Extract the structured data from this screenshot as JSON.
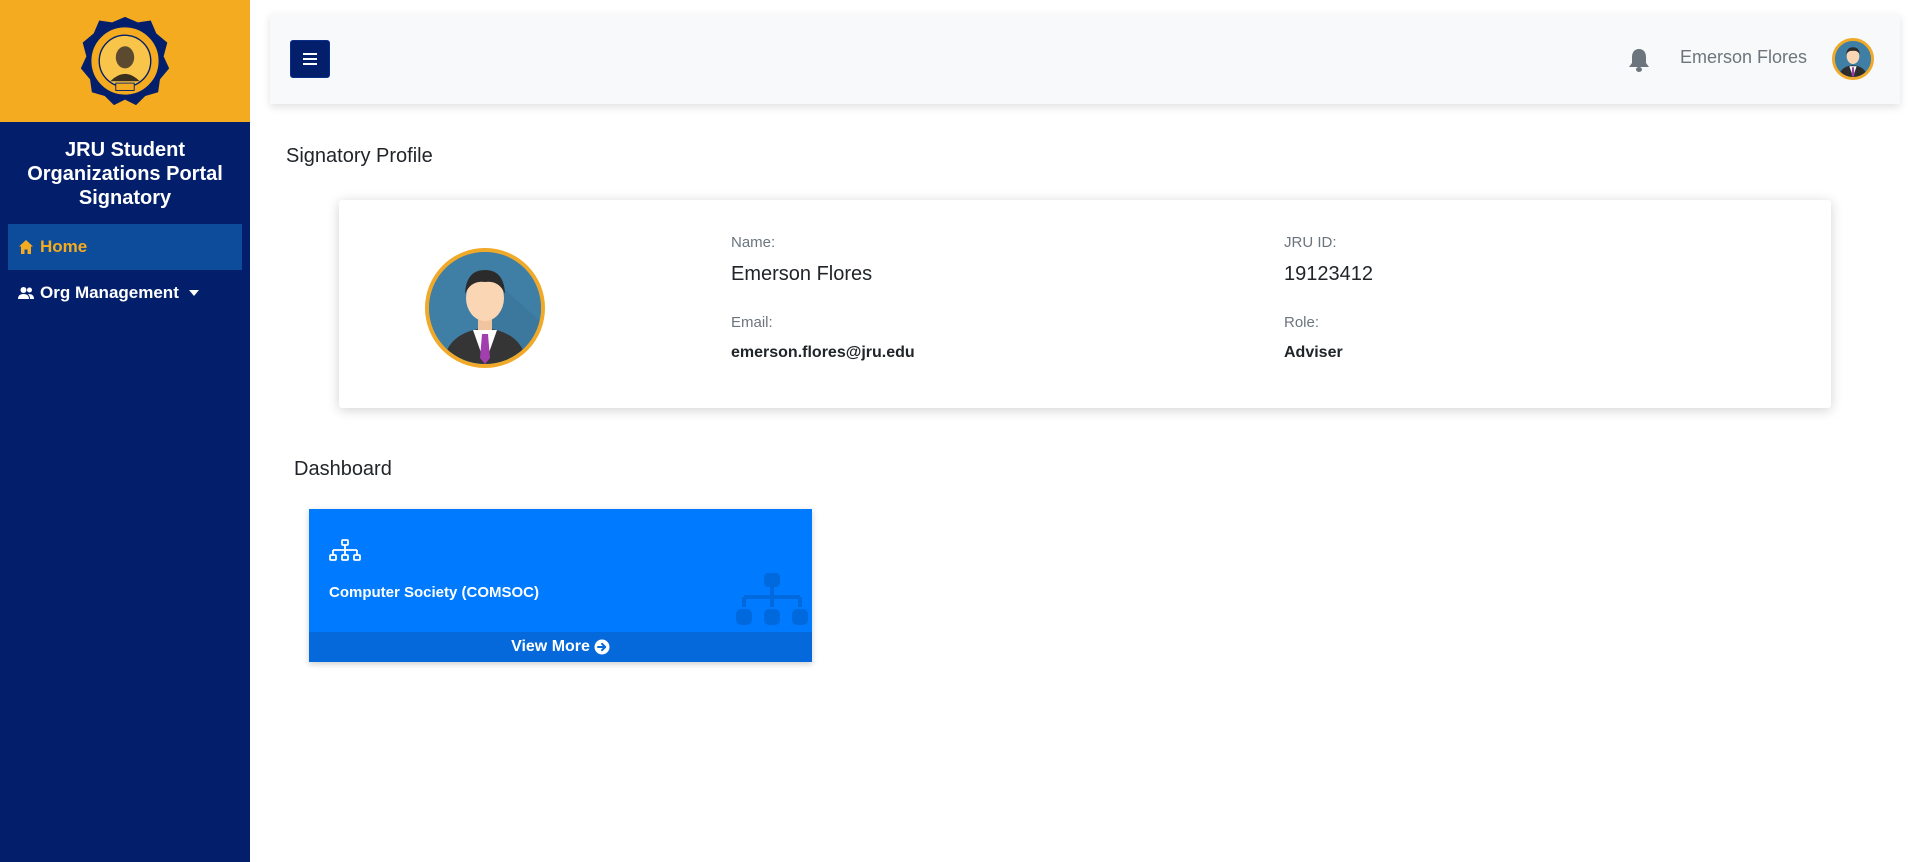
{
  "sidebar": {
    "brand": "JRU Student Organizations Portal Signatory",
    "items": [
      {
        "label": "Home",
        "icon": "home-icon",
        "active": true
      },
      {
        "label": "Org Management",
        "icon": "users-icon",
        "has_dropdown": true
      }
    ]
  },
  "topbar": {
    "menu_icon": "hamburger-icon",
    "notification_icon": "bell-icon",
    "user_name": "Emerson Flores"
  },
  "profile": {
    "section_title": "Signatory Profile",
    "name_label": "Name:",
    "name": "Emerson Flores",
    "email_label": "Email:",
    "email": "emerson.flores@jru.edu",
    "id_label": "JRU ID:",
    "jru_id": "19123412",
    "role_label": "Role:",
    "role": "Adviser"
  },
  "dashboard": {
    "section_title": "Dashboard",
    "cards": [
      {
        "org_name": "Computer Society (COMSOC)",
        "link_label": "View More",
        "icon": "sitemap-icon"
      }
    ]
  },
  "colors": {
    "sidebar": "#031f6b",
    "logo_bg": "#f5ab1f",
    "accent": "#f5ab1f",
    "card_primary": "#007bff"
  }
}
